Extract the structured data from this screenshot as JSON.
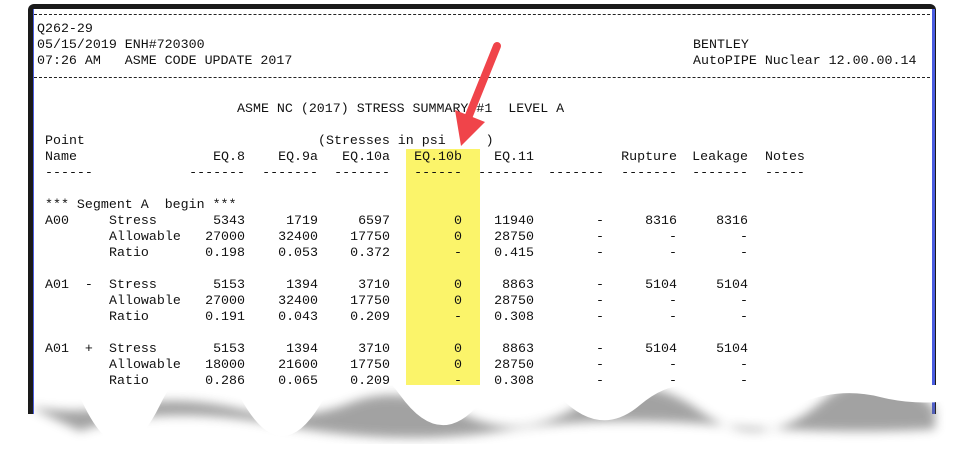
{
  "header": {
    "job": "Q262-29",
    "date_line": "05/15/2019 ENH#720300",
    "time_line": "07:26 AM   ASME CODE UPDATE 2017",
    "company": "BENTLEY",
    "product": "AutoPIPE Nuclear 12.00.00.14"
  },
  "report": {
    "title": "ASME NC (2017) STRESS SUMMARY #1  LEVEL A",
    "units": "(Stresses in psi     )",
    "point_label": "Point",
    "name_label": "Name",
    "columns": [
      "EQ.8",
      "EQ.9a",
      "EQ.10a",
      "EQ.10b",
      "EQ.11",
      "",
      "Rupture",
      "Leakage",
      "Notes"
    ],
    "segment": "*** Segment A  begin ***",
    "groups": [
      {
        "point": "A00",
        "rows": [
          {
            "label": "Stress",
            "values": [
              "5343",
              "1719",
              "6597",
              "0",
              "11940",
              "-",
              "8316",
              "8316"
            ]
          },
          {
            "label": "Allowable",
            "values": [
              "27000",
              "32400",
              "17750",
              "0",
              "28750",
              "-",
              "-",
              "-"
            ]
          },
          {
            "label": "Ratio",
            "values": [
              "0.198",
              "0.053",
              "0.372",
              "-",
              "0.415",
              "-",
              "-",
              "-"
            ]
          }
        ]
      },
      {
        "point": "A01  -",
        "rows": [
          {
            "label": "Stress",
            "values": [
              "5153",
              "1394",
              "3710",
              "0",
              "8863",
              "-",
              "5104",
              "5104"
            ]
          },
          {
            "label": "Allowable",
            "values": [
              "27000",
              "32400",
              "17750",
              "0",
              "28750",
              "-",
              "-",
              "-"
            ]
          },
          {
            "label": "Ratio",
            "values": [
              "0.191",
              "0.043",
              "0.209",
              "-",
              "0.308",
              "-",
              "-",
              "-"
            ]
          }
        ]
      },
      {
        "point": "A01  +",
        "rows": [
          {
            "label": "Stress",
            "values": [
              "5153",
              "1394",
              "3710",
              "0",
              "8863",
              "-",
              "5104",
              "5104"
            ]
          },
          {
            "label": "Allowable",
            "values": [
              "18000",
              "21600",
              "17750",
              "0",
              "28750",
              "-",
              "-",
              "-"
            ]
          },
          {
            "label": "Ratio",
            "values": [
              "0.286",
              "0.065",
              "0.209",
              "-",
              "0.308",
              "-",
              "-",
              "-"
            ]
          }
        ]
      }
    ]
  },
  "colors": {
    "highlight": "#fbf35a",
    "arrow": "#f0444a",
    "border": "#4a5de0"
  }
}
